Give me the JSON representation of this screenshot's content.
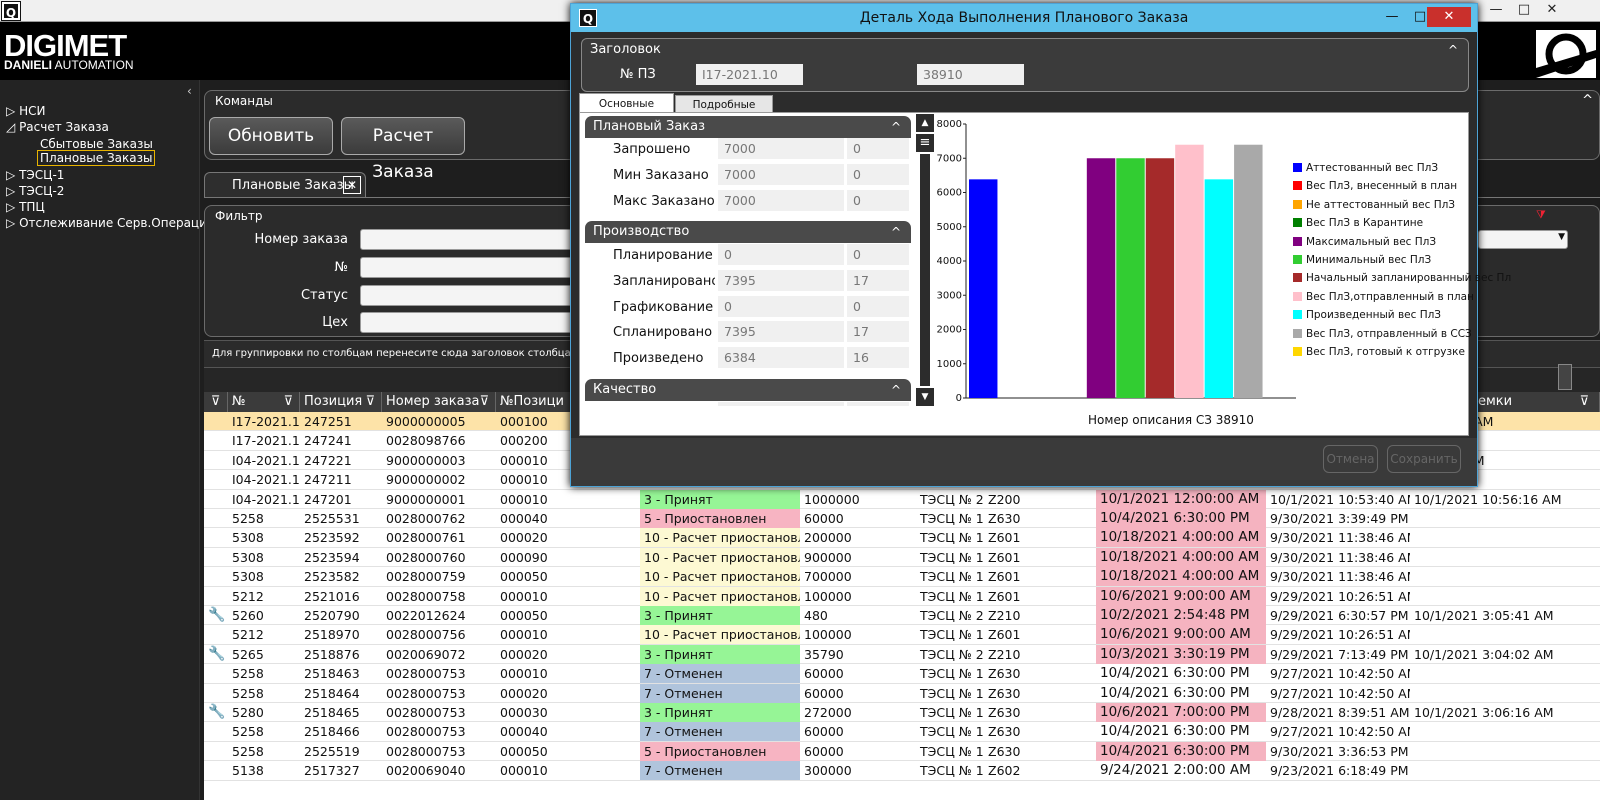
{
  "app": {
    "icon": "Q",
    "controls": [
      "—",
      "□",
      "✕"
    ],
    "logo_main": "DIGIMET",
    "logo_sub_bold": "DANIELI",
    "logo_sub": "AUTOMATION"
  },
  "tree": {
    "items": [
      {
        "label": "НСИ",
        "expander": "▷"
      },
      {
        "label": "Расчет Заказа",
        "expander": "◿"
      },
      {
        "label": "Сбытовые Заказы",
        "expander": ""
      },
      {
        "label": "Плановые Заказы",
        "expander": ""
      },
      {
        "label": "ТЭСЦ-1",
        "expander": "▷"
      },
      {
        "label": "ТЭСЦ-2",
        "expander": "▷"
      },
      {
        "label": "ТПЦ",
        "expander": "▷"
      },
      {
        "label": "Отслеживание Серв.Операций",
        "expander": "▷"
      }
    ],
    "collapse": "‹"
  },
  "commands": {
    "title": "Команды",
    "refresh": "Обновить",
    "calc": "Расчет Заказа",
    "collapse": "^"
  },
  "doc_tab": {
    "label": "Плановые Заказы",
    "close": "✕"
  },
  "filter": {
    "title": "Фильтр",
    "labels": [
      "Номер заказа",
      "№",
      "Статус",
      "Цех"
    ]
  },
  "group_hint": "Для группировки по столбцам перенесите сюда заголовок столбца",
  "grid": {
    "headers": [
      "№",
      "Позиция",
      "Номер заказа",
      "№Позици",
      "емки"
    ],
    "rows": [
      {
        "wrench": false,
        "no": "I17-2021.10",
        "pos": "247251",
        "order": "9000000005",
        "item": "000100",
        "status": "",
        "st": "",
        "weight": "",
        "shop": "",
        "line": "",
        "plan": "",
        "created": "",
        "extra": "10:53:13 AM"
      },
      {
        "wrench": false,
        "no": "I17-2021.10",
        "pos": "247241",
        "order": "0028098766",
        "item": "000200",
        "status": "",
        "st": "",
        "weight": "",
        "shop": "",
        "line": "",
        "plan": "",
        "created": "",
        "extra": ""
      },
      {
        "wrench": false,
        "no": "I04-2021.10",
        "pos": "247221",
        "order": "9000000003",
        "item": "000010",
        "status": "",
        "st": "",
        "weight": "",
        "shop": "",
        "line": "",
        "plan": "",
        "created": "",
        "extra": "3:06:23 PM"
      },
      {
        "wrench": false,
        "no": "I04-2021.10",
        "pos": "247211",
        "order": "9000000002",
        "item": "000010",
        "status": "",
        "st": "",
        "weight": "",
        "shop": "",
        "line": "",
        "plan": "",
        "created": "",
        "extra": ""
      },
      {
        "wrench": false,
        "no": "I04-2021.10",
        "pos": "247201",
        "order": "9000000001",
        "item": "000010",
        "status": "3 - Принят",
        "st": "g",
        "weight": "1000000",
        "shop": "ТЭСЦ № 2",
        "line": "Z200",
        "plan": "10/1/2021 12:00:00 AM",
        "hl": true,
        "created": "10/1/2021 10:53:40 AM",
        "extra": "10/1/2021 10:56:16 AM"
      },
      {
        "wrench": false,
        "no": "5258",
        "pos": "2525531",
        "order": "0028000762",
        "item": "000040",
        "status": "5 - Приостановлен",
        "st": "p",
        "weight": "60000",
        "shop": "ТЭСЦ № 1",
        "line": "Z630",
        "plan": "10/4/2021 6:30:00 PM",
        "hl": true,
        "created": "9/30/2021 3:39:49 PM",
        "extra": ""
      },
      {
        "wrench": false,
        "no": "5308",
        "pos": "2523592",
        "order": "0028000761",
        "item": "000020",
        "status": "10 - Расчет приостановлен",
        "st": "y",
        "weight": "200000",
        "shop": "ТЭСЦ № 1",
        "line": "Z601",
        "plan": "10/18/2021 4:00:00 AM",
        "hl": true,
        "created": "9/30/2021 11:38:46 AM",
        "extra": ""
      },
      {
        "wrench": false,
        "no": "5308",
        "pos": "2523594",
        "order": "0028000760",
        "item": "000090",
        "status": "10 - Расчет приостановлен",
        "st": "y",
        "weight": "900000",
        "shop": "ТЭСЦ № 1",
        "line": "Z601",
        "plan": "10/18/2021 4:00:00 AM",
        "hl": true,
        "created": "9/30/2021 11:38:46 AM",
        "extra": ""
      },
      {
        "wrench": false,
        "no": "5308",
        "pos": "2523582",
        "order": "0028000759",
        "item": "000050",
        "status": "10 - Расчет приостановлен",
        "st": "y",
        "weight": "700000",
        "shop": "ТЭСЦ № 1",
        "line": "Z601",
        "plan": "10/18/2021 4:00:00 AM",
        "hl": true,
        "created": "9/30/2021 11:38:46 AM",
        "extra": ""
      },
      {
        "wrench": false,
        "no": "5212",
        "pos": "2521016",
        "order": "0028000758",
        "item": "000010",
        "status": "10 - Расчет приостановлен",
        "st": "y",
        "weight": "100000",
        "shop": "ТЭСЦ № 1",
        "line": "Z601",
        "plan": "10/6/2021 9:00:00 AM",
        "hl": true,
        "created": "9/29/2021 10:26:51 AM",
        "extra": ""
      },
      {
        "wrench": true,
        "no": "5260",
        "pos": "2520790",
        "order": "0022012624",
        "item": "000050",
        "status": "3 - Принят",
        "st": "g",
        "weight": "480",
        "shop": "ТЭСЦ № 2",
        "line": "Z210",
        "plan": "10/2/2021 2:54:48 PM",
        "hl": true,
        "created": "9/29/2021 6:30:57 PM",
        "extra": "10/1/2021 3:05:41 AM"
      },
      {
        "wrench": false,
        "no": "5212",
        "pos": "2518970",
        "order": "0028000756",
        "item": "000010",
        "status": "10 - Расчет приостановлен",
        "st": "y",
        "weight": "100000",
        "shop": "ТЭСЦ № 1",
        "line": "Z601",
        "plan": "10/6/2021 9:00:00 AM",
        "hl": true,
        "created": "9/29/2021 10:26:51 AM",
        "extra": ""
      },
      {
        "wrench": true,
        "no": "5265",
        "pos": "2518876",
        "order": "0020069072",
        "item": "000020",
        "status": "3 - Принят",
        "st": "g",
        "weight": "35790",
        "shop": "ТЭСЦ № 2",
        "line": "Z210",
        "plan": "10/3/2021 3:30:19 PM",
        "hl": true,
        "created": "9/29/2021 7:13:49 PM",
        "extra": "10/1/2021 3:04:02 AM"
      },
      {
        "wrench": false,
        "no": "5258",
        "pos": "2518463",
        "order": "0028000753",
        "item": "000010",
        "status": "7 - Отменен",
        "st": "b",
        "weight": "60000",
        "shop": "ТЭСЦ № 1",
        "line": "Z630",
        "plan": "10/4/2021 6:30:00 PM",
        "hl": false,
        "created": "9/27/2021 10:42:50 AM",
        "extra": ""
      },
      {
        "wrench": false,
        "no": "5258",
        "pos": "2518464",
        "order": "0028000753",
        "item": "000020",
        "status": "7 - Отменен",
        "st": "b",
        "weight": "60000",
        "shop": "ТЭСЦ № 1",
        "line": "Z630",
        "plan": "10/4/2021 6:30:00 PM",
        "hl": false,
        "created": "9/27/2021 10:42:50 AM",
        "extra": ""
      },
      {
        "wrench": true,
        "no": "5280",
        "pos": "2518465",
        "order": "0028000753",
        "item": "000030",
        "status": "3 - Принят",
        "st": "g",
        "weight": "272000",
        "shop": "ТЭСЦ № 1",
        "line": "Z630",
        "plan": "10/6/2021 7:00:00 PM",
        "hl": true,
        "created": "9/28/2021 8:39:51 AM",
        "extra": "10/1/2021 3:06:16 AM"
      },
      {
        "wrench": false,
        "no": "5258",
        "pos": "2518466",
        "order": "0028000753",
        "item": "000040",
        "status": "7 - Отменен",
        "st": "b",
        "weight": "60000",
        "shop": "ТЭСЦ № 1",
        "line": "Z630",
        "plan": "10/4/2021 6:30:00 PM",
        "hl": false,
        "created": "9/27/2021 10:42:50 AM",
        "extra": ""
      },
      {
        "wrench": false,
        "no": "5258",
        "pos": "2525519",
        "order": "0028000753",
        "item": "000050",
        "status": "5 - Приостановлен",
        "st": "p",
        "weight": "60000",
        "shop": "ТЭСЦ № 1",
        "line": "Z630",
        "plan": "10/4/2021 6:30:00 PM",
        "hl": true,
        "created": "9/30/2021 3:36:53 PM",
        "extra": ""
      },
      {
        "wrench": false,
        "no": "5138",
        "pos": "2517327",
        "order": "0020069040",
        "item": "000010",
        "status": "7 - Отменен",
        "st": "b",
        "weight": "300000",
        "shop": "ТЭСЦ № 1",
        "line": "Z602",
        "plan": "9/24/2021 2:00:00 AM",
        "hl": false,
        "created": "9/23/2021 6:18:49 PM",
        "extra": ""
      }
    ]
  },
  "modal": {
    "icon": "Q",
    "title": "Деталь Хода Выполнения Планового Заказа",
    "controls": [
      "—",
      "□",
      "✕"
    ],
    "header_section": "Заголовок",
    "pz_label": "№ ПЗ",
    "pz_value": "I17-2021.10",
    "pz_id": "38910",
    "tabs": [
      "Основные данные",
      "Подробные данные"
    ],
    "plan_section": "Плановый Заказ",
    "plan_rows": [
      {
        "label": "Запрошено",
        "v1": "7000",
        "v2": "0"
      },
      {
        "label": "Мин Заказано",
        "v1": "7000",
        "v2": "0"
      },
      {
        "label": "Макс Заказано",
        "v1": "7000",
        "v2": "0"
      }
    ],
    "prod_section": "Производство",
    "prod_rows": [
      {
        "label": "Планирование",
        "v1": "0",
        "v2": "0"
      },
      {
        "label": "Запланировано",
        "v1": "7395",
        "v2": "17"
      },
      {
        "label": "Графикование",
        "v1": "0",
        "v2": "0"
      },
      {
        "label": "Спланировано",
        "v1": "7395",
        "v2": "17"
      },
      {
        "label": "Произведено",
        "v1": "6384",
        "v2": "16"
      }
    ],
    "quality_section": "Качество",
    "chev_up": "^",
    "scroll_up": "▲",
    "scroll_down": "▼",
    "cancel": "Отмена",
    "save": "Сохранить"
  },
  "chart_data": {
    "type": "bar",
    "xlabel": "Номер описания СЗ 38910",
    "ylim": [
      0,
      8000
    ],
    "yticks": [
      0,
      1000,
      2000,
      3000,
      4000,
      5000,
      6000,
      7000,
      8000
    ],
    "series": [
      {
        "name": "Аттестованный вес ПлЗ",
        "value": 6384,
        "color": "#0000ff"
      },
      {
        "name": "Вес ПлЗ, внесенный в план",
        "value": 0,
        "color": "#ff0000"
      },
      {
        "name": "Не аттестованный вес ПлЗ",
        "value": 0,
        "color": "#ffa500"
      },
      {
        "name": "Вес ПлЗ в Карантине",
        "value": 0,
        "color": "#008000"
      },
      {
        "name": "Максимальный вес ПлЗ",
        "value": 7000,
        "color": "#800080"
      },
      {
        "name": "Минимальный вес ПлЗ",
        "value": 7000,
        "color": "#32cd32"
      },
      {
        "name": "Начальный запланированный вес Пл",
        "value": 7000,
        "color": "#a52a2a"
      },
      {
        "name": "Вес ПлЗ,отправленный в план",
        "value": 7395,
        "color": "#ffc0cb"
      },
      {
        "name": "Произведенный вес ПлЗ",
        "value": 6384,
        "color": "#00ffff"
      },
      {
        "name": "Вес ПлЗ, отправленный в ССЗ",
        "value": 7395,
        "color": "#a9a9a9"
      },
      {
        "name": "Вес ПлЗ, готовый к отгрузке",
        "value": 0,
        "color": "#ffd700"
      }
    ],
    "legend": "right"
  }
}
